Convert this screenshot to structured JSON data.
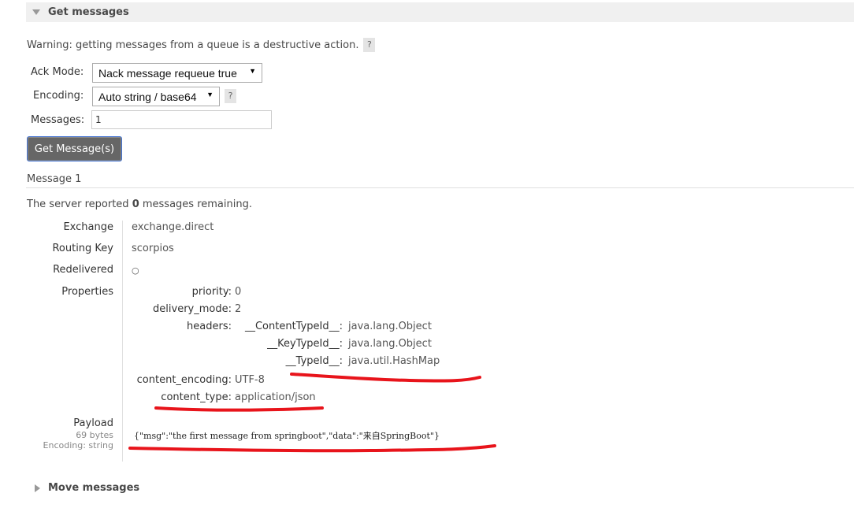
{
  "get_section": {
    "title": "Get messages"
  },
  "warning": {
    "text": "Warning: getting messages from a queue is a destructive action.",
    "help": "?"
  },
  "form": {
    "ack_mode": {
      "label": "Ack Mode:",
      "value": "Nack message requeue true"
    },
    "encoding": {
      "label": "Encoding:",
      "value": "Auto string / base64",
      "help": "?"
    },
    "messages": {
      "label": "Messages:",
      "value": "1"
    },
    "submit_label": "Get Message(s)"
  },
  "message": {
    "heading": "Message 1",
    "server_prefix": "The server reported ",
    "server_count": "0",
    "server_suffix": " messages remaining.",
    "exchange": {
      "label": "Exchange",
      "value": "exchange.direct"
    },
    "routing_key": {
      "label": "Routing Key",
      "value": "scorpios"
    },
    "redelivered": {
      "label": "Redelivered",
      "value": "○"
    },
    "properties": {
      "label": "Properties",
      "priority": {
        "key": "priority:",
        "value": "0"
      },
      "delivery_mode": {
        "key": "delivery_mode:",
        "value": "2"
      },
      "headers": {
        "key": "headers:",
        "items": [
          {
            "key": "__ContentTypeId__:",
            "value": "java.lang.Object"
          },
          {
            "key": "__KeyTypeId__:",
            "value": "java.lang.Object"
          },
          {
            "key": "__TypeId__:",
            "value": "java.util.HashMap"
          }
        ]
      },
      "content_encoding": {
        "key": "content_encoding:",
        "value": "UTF-8"
      },
      "content_type": {
        "key": "content_type:",
        "value": "application/json"
      }
    },
    "payload": {
      "label": "Payload",
      "size": "69 bytes",
      "encoding": "Encoding: string",
      "body": "{\"msg\":\"the first message from springboot\",\"data\":\"来自SpringBoot\"}"
    }
  },
  "move_section": {
    "title": "Move messages"
  },
  "colors": {
    "annotation": "#e8141b",
    "button_bg": "#666666",
    "header_bg": "#f0f0f0"
  }
}
